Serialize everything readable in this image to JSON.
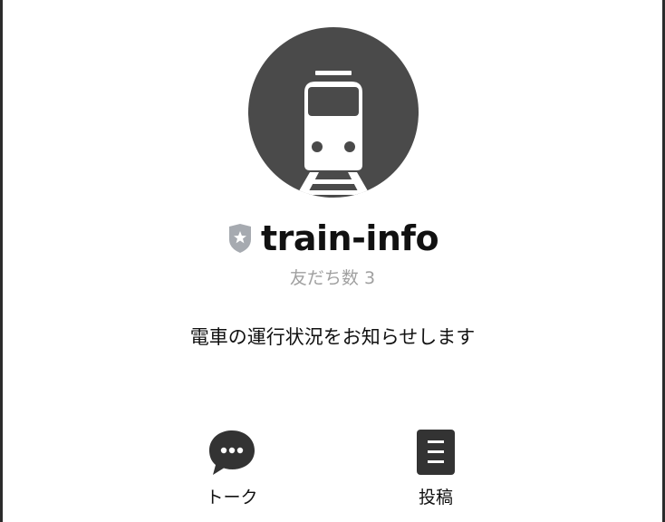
{
  "profile": {
    "account_name": "train-info",
    "friends_count": "友だち数 3",
    "description": "電車の運行状況をお知らせします",
    "avatar_icon": "train-icon",
    "badge_icon": "shield-star-icon"
  },
  "actions": [
    {
      "label": "トーク",
      "icon": "chat-bubble-icon"
    },
    {
      "label": "投稿",
      "icon": "document-icon"
    }
  ],
  "colors": {
    "avatar_bg": "#4a4a4a",
    "text_primary": "#111111",
    "text_secondary": "#a0a0a0",
    "badge": "#a6aab0",
    "icon_dark": "#333333"
  }
}
